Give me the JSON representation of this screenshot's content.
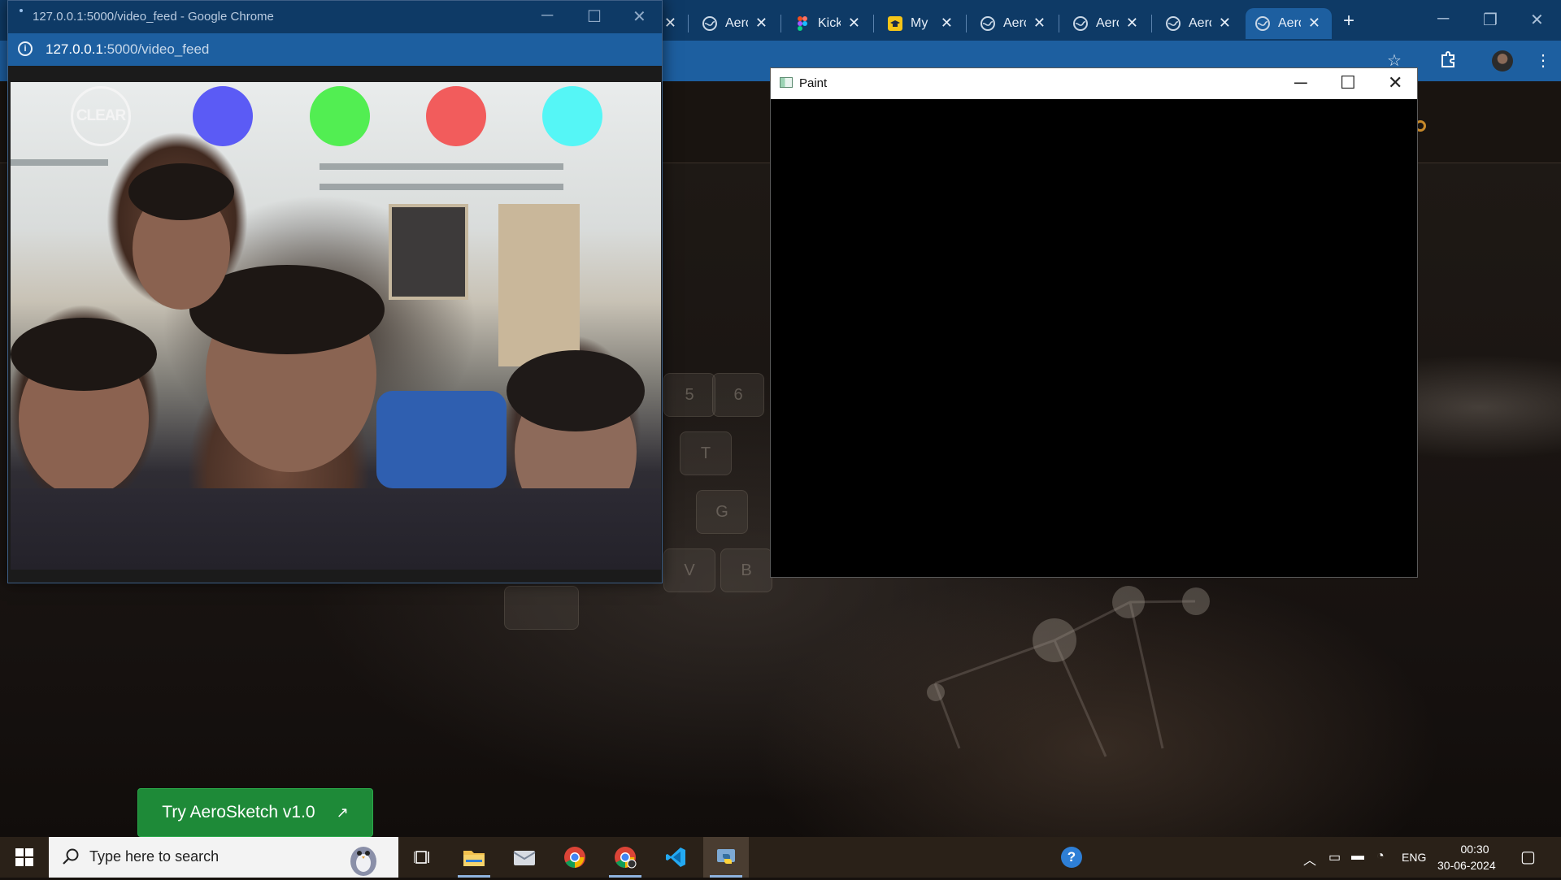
{
  "background_browser": {
    "tabs": [
      {
        "title": "",
        "icon": "close-only"
      },
      {
        "title": "Aero",
        "icon": "globe-icon"
      },
      {
        "title": "Kick",
        "icon": "figma-icon"
      },
      {
        "title": "My",
        "icon": "cap-icon"
      },
      {
        "title": "Aero",
        "icon": "globe-icon"
      },
      {
        "title": "Aero",
        "icon": "globe-icon"
      },
      {
        "title": "Aero",
        "icon": "globe-icon"
      },
      {
        "title": "Aero",
        "icon": "globe-icon",
        "active": true
      }
    ],
    "new_tab_label": "+",
    "cta_label": "Try AeroSketch v1.0",
    "cta_arrow": "↗"
  },
  "video_window": {
    "title": "127.0.0.1:5000/video_feed - Google Chrome",
    "url_host": "127.0.0.1",
    "url_rest": ":5000/video_feed",
    "clear_label": "CLEAR",
    "swatches": [
      {
        "name": "blue",
        "color": "#5b5bf5"
      },
      {
        "name": "green",
        "color": "#52ee52"
      },
      {
        "name": "red",
        "color": "#f25c5c"
      },
      {
        "name": "cyan",
        "color": "#55f6f6"
      }
    ]
  },
  "paint_window": {
    "title": "Paint"
  },
  "taskbar": {
    "search_placeholder": "Type here to search",
    "language": "ENG",
    "time": "00:30",
    "date": "30-06-2024"
  },
  "colors": {
    "tabstrip": "#0e3a66",
    "toolbar": "#1d5fa0",
    "cta_green": "#1e8a38",
    "taskbar": "#2a2118"
  }
}
